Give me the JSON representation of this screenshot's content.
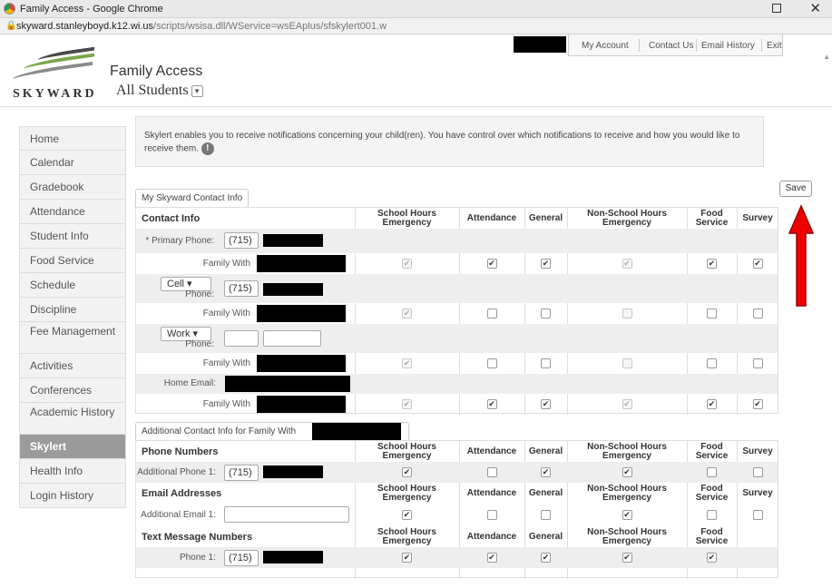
{
  "window": {
    "title": "Family Access - Google Chrome",
    "url_host": "skyward.stanleyboyd.k12.wi.us",
    "url_path": "/scripts/wsisa.dll/WService=wsEAplus/sfskylert001.w"
  },
  "header": {
    "logo_text": "SKYWARD",
    "app_title": "Family Access",
    "student_select": "All Students",
    "links": [
      "My Account",
      "Contact Us",
      "Email History",
      "Exit"
    ]
  },
  "sidebar": {
    "items": [
      "Home",
      "Calendar",
      "Gradebook",
      "Attendance",
      "Student Info",
      "Food Service",
      "Schedule",
      "Discipline",
      "Fee Management",
      "Activities",
      "Conferences",
      "Academic History",
      "Skylert",
      "Health Info",
      "Login History"
    ],
    "active": "Skylert"
  },
  "info": {
    "text": "Skylert enables you to receive notifications concerning your child(ren). You have control over which notifications to receive and how you would like to receive them."
  },
  "save_label": "Save",
  "section1": {
    "tab": "My Skyward Contact Info",
    "contact_header": "Contact Info",
    "columns": [
      "School Hours Emergency",
      "Attendance",
      "General",
      "Non-School Hours Emergency",
      "Food Service",
      "Survey"
    ],
    "primary_label": "* Primary Phone:",
    "primary_area": "(715)",
    "cell_type": "Cell",
    "cell_area": "(715)",
    "phone_label": "Phone:",
    "work_type": "Work",
    "family_with": "Family With",
    "home_email_label": "Home Email:",
    "rows": [
      [
        true,
        true,
        true,
        true,
        true,
        true
      ],
      [
        true,
        false,
        false,
        false,
        false,
        false
      ],
      [
        true,
        false,
        false,
        false,
        false,
        false
      ],
      [
        true,
        true,
        true,
        true,
        true,
        true
      ]
    ]
  },
  "section2": {
    "tab": "Additional Contact Info for Family With",
    "phone_header": "Phone Numbers",
    "email_header": "Email Addresses",
    "text_header": "Text Message Numbers",
    "columns": [
      "School Hours Emergency",
      "Attendance",
      "General",
      "Non-School Hours Emergency",
      "Food Service",
      "Survey"
    ],
    "additional_phone_label": "Additional Phone 1:",
    "additional_phone_area": "(715)",
    "additional_email_label": "Additional Email 1:",
    "text_phone_label": "Phone 1:",
    "text_phone_area": "(715)",
    "phone_row": [
      true,
      false,
      true,
      true,
      false,
      false
    ],
    "email_row": [
      true,
      false,
      false,
      true,
      false,
      false
    ],
    "text_row": [
      true,
      true,
      true,
      true,
      true
    ]
  }
}
